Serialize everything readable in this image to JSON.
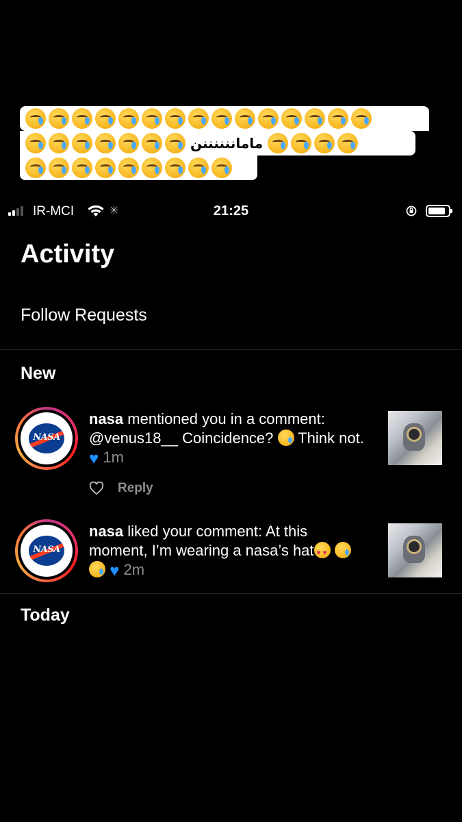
{
  "sticker": {
    "row1_count": 15,
    "row2_before_count": 7,
    "row2_text": "ماماننننننن",
    "row2_after_count": 4,
    "row3_count": 9,
    "emoji_name": "face-holding-back-tears"
  },
  "status_bar": {
    "carrier": "IR-MCI",
    "time": "21:25",
    "signal_bars": 4,
    "signal_bars_active": 2
  },
  "header": {
    "title": "Activity"
  },
  "follow_requests": {
    "label": "Follow Requests"
  },
  "sections": {
    "new": "New",
    "today": "Today"
  },
  "notifications": [
    {
      "user": "nasa",
      "text_before": " mentioned you in a comment: @venus18__ Coincidence? ",
      "text_after": " Think not. ",
      "time": "1m",
      "reply_label": "Reply"
    },
    {
      "user": "nasa",
      "text_before": " liked your comment: At this moment, I’m wearing a nasa’s hat",
      "time": "2m"
    }
  ],
  "avatar_logo_text": "NASA",
  "colors": {
    "background": "#000000",
    "muted_text": "#8e8e8e",
    "divider": "#262626",
    "blue_heart": "#1f8fff"
  }
}
